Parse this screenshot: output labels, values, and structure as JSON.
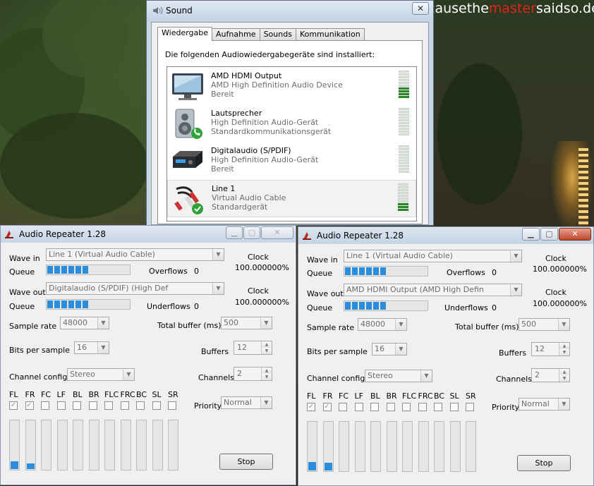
{
  "watermark": {
    "part1": "causethe",
    "part2": "master",
    "part3": "saidso.de"
  },
  "sound": {
    "title": "Sound",
    "close_glyph": "✕",
    "tabs": [
      {
        "label": "Wiedergabe"
      },
      {
        "label": "Aufnahme"
      },
      {
        "label": "Sounds"
      },
      {
        "label": "Kommunikation"
      }
    ],
    "intro": "Die folgenden Audiowiedergabegeräte sind installiert:",
    "devices": [
      {
        "name": "AMD HDMI Output",
        "desc": "AMD High Definition Audio Device",
        "status": "Bereit",
        "icon": "monitor-icon",
        "level": 0.4
      },
      {
        "name": "Lautsprecher",
        "desc": "High Definition Audio-Gerät",
        "status": "Standardkommunikationsgerät",
        "icon": "speaker-icon",
        "level": 0.0
      },
      {
        "name": "Digitalaudio (S/PDIF)",
        "desc": "High Definition Audio-Gerät",
        "status": "Bereit",
        "icon": "digital-audio-icon",
        "level": 0.0
      },
      {
        "name": "Line 1",
        "desc": "Virtual Audio Cable",
        "status": "Standardgerät",
        "icon": "audio-cable-icon",
        "level": 0.3
      }
    ]
  },
  "repeaters": [
    {
      "title": "Audio Repeater 1.28",
      "wave_in_label": "Wave in",
      "wave_in": "Line 1 (Virtual Audio Cable)",
      "queue_label": "Queue",
      "queue_in": 0.5,
      "overflows_label": "Overflows",
      "overflows": "0",
      "clock_label": "Clock",
      "clock_in": "100.000000%",
      "wave_out_label": "Wave out",
      "wave_out": "Digitalaudio (S/PDIF) (High Def",
      "queue_out": 0.5,
      "underflows_label": "Underflows",
      "underflows": "0",
      "clock_out": "100.000000%",
      "sample_rate_label": "Sample rate",
      "sample_rate": "48000",
      "total_buffer_label": "Total buffer (ms)",
      "total_buffer": "500",
      "bits_label": "Bits per sample",
      "bits": "16",
      "buffers_label": "Buffers",
      "buffers": "12",
      "channel_config_label": "Channel config",
      "channel_config": "Stereo",
      "channels_label": "Channels",
      "channels": "2",
      "priority_label": "Priority",
      "priority": "Normal",
      "stop_label": "Stop",
      "channel_names": [
        "FL",
        "FR",
        "FC",
        "LF",
        "BL",
        "BR",
        "FLC",
        "FRC",
        "BC",
        "SL",
        "SR"
      ],
      "channel_checked": [
        true,
        true,
        false,
        false,
        false,
        false,
        false,
        false,
        false,
        false,
        false
      ],
      "channel_levels": [
        0.15,
        0.12,
        0,
        0,
        0,
        0,
        0,
        0,
        0,
        0,
        0
      ]
    },
    {
      "title": "Audio Repeater 1.28",
      "wave_in_label": "Wave in",
      "wave_in": "Line 1 (Virtual Audio Cable)",
      "queue_label": "Queue",
      "queue_in": 0.5,
      "overflows_label": "Overflows",
      "overflows": "0",
      "clock_label": "Clock",
      "clock_in": "100.000000%",
      "wave_out_label": "Wave out",
      "wave_out": "AMD HDMI Output (AMD High Defin",
      "queue_out": 0.5,
      "underflows_label": "Underflows",
      "underflows": "0",
      "clock_out": "100.000000%",
      "sample_rate_label": "Sample rate",
      "sample_rate": "48000",
      "total_buffer_label": "Total buffer (ms)",
      "total_buffer": "500",
      "bits_label": "Bits per sample",
      "bits": "16",
      "buffers_label": "Buffers",
      "buffers": "12",
      "channel_config_label": "Channel config",
      "channel_config": "Stereo",
      "channels_label": "Channels",
      "channels": "2",
      "priority_label": "Priority",
      "priority": "Normal",
      "stop_label": "Stop",
      "channel_names": [
        "FL",
        "FR",
        "FC",
        "LF",
        "BL",
        "BR",
        "FLC",
        "FRC",
        "BC",
        "SL",
        "SR"
      ],
      "channel_checked": [
        true,
        true,
        false,
        false,
        false,
        false,
        false,
        false,
        false,
        false,
        false
      ],
      "channel_levels": [
        0.17,
        0.15,
        0,
        0,
        0,
        0,
        0,
        0,
        0,
        0,
        0
      ]
    }
  ]
}
